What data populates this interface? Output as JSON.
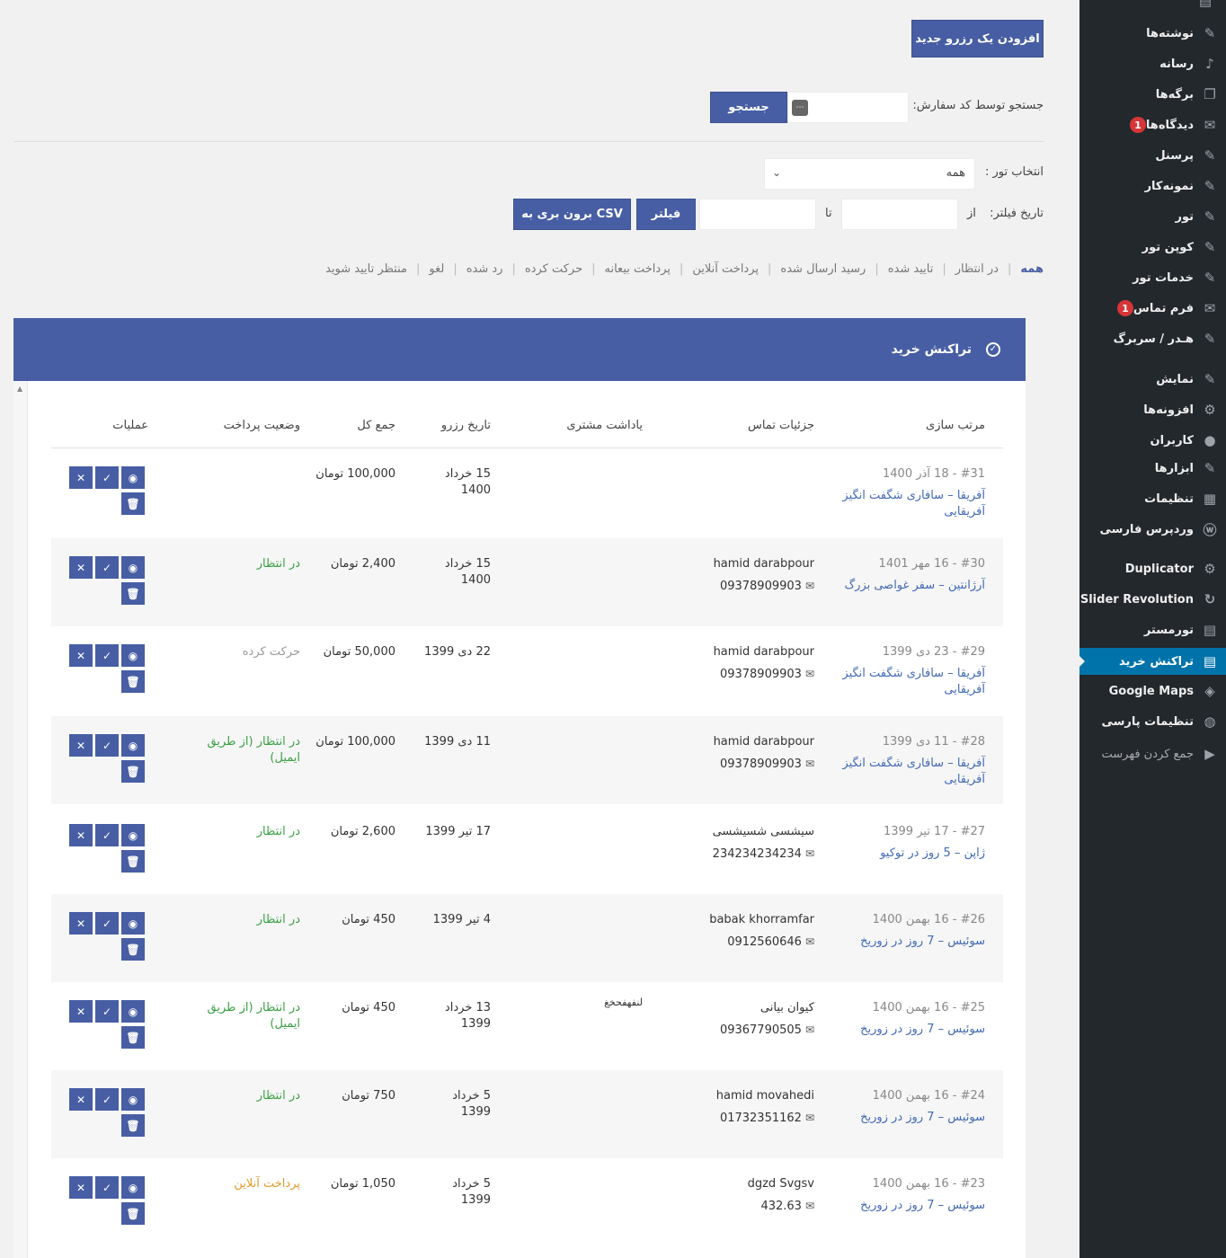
{
  "header": {
    "add_booking": "افزودن یک رزرو جدید",
    "search_label": "جستجو توسط کد سفارش:",
    "search_button": "جستجو",
    "tour_select_label": "انتخاب تور :",
    "tour_select_value": "همه",
    "filter_date_label": "تاریخ فیلتر:",
    "from_label": "از",
    "to_label": "تا",
    "filter_button": "فیلتر",
    "csv_button": "برون بری به CSV"
  },
  "status_tabs": [
    "همه",
    "در انتظار",
    "تایید شده",
    "رسید ارسال شده",
    "پرداخت آنلاین",
    "پرداخت بیعانه",
    "حرکت کرده",
    "رد شده",
    "لغو",
    "منتظر تایید شوید"
  ],
  "panel": {
    "title": "تراکنش خرید"
  },
  "columns": {
    "sort": "مرتب سازی",
    "contact": "جزئیات تماس",
    "note": "یاداشت مشتری",
    "date": "تاریخ رزرو",
    "total": "جمع کل",
    "payment": "وضعیت پرداخت",
    "actions": "عملیات"
  },
  "rows": [
    {
      "order": "#31 - 18 آذر 1400",
      "tour": "آفریقا – سافاری شگفت انگیز آفریقایی",
      "name": "",
      "phone": "",
      "note": "",
      "date": "15 خرداد 1400",
      "total": "100,000 تومان",
      "payment": "",
      "payment_color": "green"
    },
    {
      "order": "#30 - 16 مهر 1401",
      "tour": "آرژانتین – سفر غواصی بزرگ",
      "name": "hamid darabpour",
      "phone": "09378909903",
      "note": "",
      "date": "15 خرداد 1400",
      "total": "2,400 تومان",
      "payment": "در انتظار",
      "payment_color": "green"
    },
    {
      "order": "#29 - 23 دی 1399",
      "tour": "آفریقا – سافاری شگفت انگیز آفریقایی",
      "name": "hamid darabpour",
      "phone": "09378909903",
      "note": "",
      "date": "22 دی 1399",
      "total": "50,000 تومان",
      "payment": "حرکت کرده",
      "payment_color": "grey"
    },
    {
      "order": "#28 - 11 دی 1399",
      "tour": "آفریقا – سافاری شگفت انگیز آفریقایی",
      "name": "hamid darabpour",
      "phone": "09378909903",
      "note": "",
      "date": "11 دی 1399",
      "total": "100,000 تومان",
      "payment": "در انتظار (از طریق ایمیل)",
      "payment_color": "green"
    },
    {
      "order": "#27 - 17 تیر 1399",
      "tour": "ژاپن – 5 روز در توکیو",
      "name": "سیشسی شسیشسی",
      "phone": "234234234234",
      "note": "",
      "date": "17 تیر 1399",
      "total": "2,600 تومان",
      "payment": "در انتظار",
      "payment_color": "green"
    },
    {
      "order": "#26 - 16 بهمن 1400",
      "tour": "سوئیس – 7 روز در زوریخ",
      "name": "babak khorramfar",
      "phone": "0912560646",
      "note": "",
      "date": "4 تیر 1399",
      "total": "450 تومان",
      "payment": "در انتظار",
      "payment_color": "green"
    },
    {
      "order": "#25 - 16 بهمن 1400",
      "tour": "سوئیس – 7 روز در زوریخ",
      "name": "کیوان بیانی",
      "phone": "09367790505",
      "note": "لنفهفحخغ",
      "date": "13 خرداد 1399",
      "total": "450 تومان",
      "payment": "در انتظار (از طریق ایمیل)",
      "payment_color": "green"
    },
    {
      "order": "#24 - 16 بهمن 1400",
      "tour": "سوئیس – 7 روز در زوریخ",
      "name": "hamid movahedi",
      "phone": "01732351162",
      "note": "",
      "date": "5 خرداد 1399",
      "total": "750 تومان",
      "payment": "در انتظار",
      "payment_color": "green"
    },
    {
      "order": "#23 - 16 بهمن 1400",
      "tour": "سوئیس – 7 روز در زوریخ",
      "name": "dgzd Svgsv",
      "phone": "432.63",
      "note": "",
      "date": "5 خرداد 1399",
      "total": "1,050 تومان",
      "payment": "پرداخت آنلاین",
      "payment_color": "orange"
    }
  ],
  "sidebar": [
    {
      "label": "نوشته‌ها",
      "icon": "pin-icon"
    },
    {
      "label": "رسانه",
      "icon": "media-icon"
    },
    {
      "label": "برگه‌ها",
      "icon": "pages-icon"
    },
    {
      "label": "دیدگاه‌ها",
      "icon": "comment-icon",
      "badge": "1"
    },
    {
      "label": "پرسنل",
      "icon": "pin-icon"
    },
    {
      "label": "نمونه‌کار",
      "icon": "pin-icon"
    },
    {
      "label": "تور",
      "icon": "pin-icon"
    },
    {
      "label": "کوپن تور",
      "icon": "pin-icon"
    },
    {
      "label": "خدمات تور",
      "icon": "pin-icon"
    },
    {
      "label": "فرم تماس",
      "icon": "mail-icon",
      "badge": "1"
    },
    {
      "label": "هـدر / سربرگ",
      "icon": "pin-icon"
    },
    {
      "label": "نمایش",
      "icon": "appearance-icon"
    },
    {
      "label": "افزونه‌ها",
      "icon": "plugin-icon"
    },
    {
      "label": "کاربران",
      "icon": "user-icon"
    },
    {
      "label": "ابزارها",
      "icon": "wrench-icon"
    },
    {
      "label": "تنظیمات",
      "icon": "settings-icon"
    },
    {
      "label": "وردپرس فارسی",
      "icon": "wp-icon"
    },
    {
      "label": "Duplicator",
      "icon": "duplicator-icon"
    },
    {
      "label": "Slider Revolution",
      "icon": "refresh-icon"
    },
    {
      "label": "تورمستر",
      "icon": "stack-icon"
    },
    {
      "label": "تراکنش خرید",
      "icon": "stack-icon",
      "active": true
    },
    {
      "label": "Google Maps",
      "icon": "map-icon"
    },
    {
      "label": "تنظیمات پارسی",
      "icon": "globe-icon"
    },
    {
      "label": "جمع کردن فهرست",
      "icon": "play-icon"
    }
  ]
}
